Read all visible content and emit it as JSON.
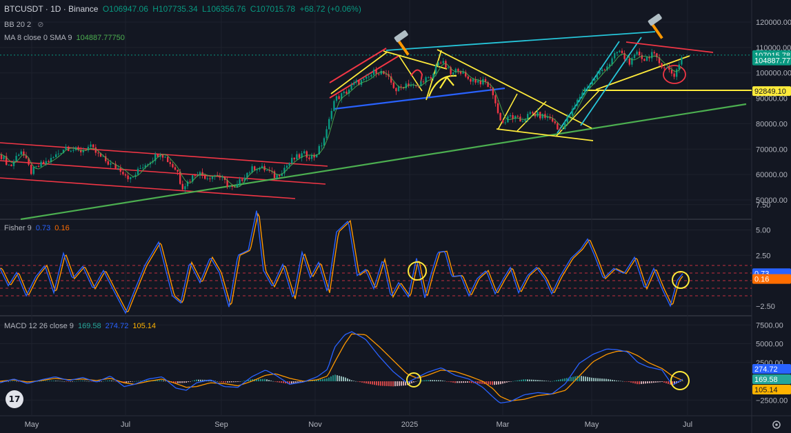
{
  "header": {
    "symbol": "BTCUSDT · 1D · Binance",
    "open": "O106947.06",
    "high": "H107735.34",
    "low": "L106356.76",
    "close": "C107015.78",
    "change": "+68.72 (+0.06%)",
    "bb_label": "BB 20 2",
    "ma_label": "MA 8 close 0 SMA 9",
    "ma_value": "104887.77750"
  },
  "fisher": {
    "label": "Fisher 9",
    "v1": "0.73",
    "v2": "0.16"
  },
  "macd": {
    "label": "MACD 12 26 close 9",
    "v1": "169.58",
    "v2": "274.72",
    "v3": "105.14"
  },
  "chart_data": {
    "type": "candlestick",
    "x_ticks": [
      "May",
      "Jul",
      "Sep",
      "Nov",
      "2025",
      "Mar",
      "May",
      "Jul"
    ],
    "price_axis": [
      "120000.00",
      "110000.00",
      "100000.00",
      "90000.00",
      "80000.00",
      "70000.00",
      "60000.00",
      "50000.00"
    ],
    "fisher_axis": [
      "7.50",
      "5.00",
      "2.50",
      "−2.50"
    ],
    "macd_axis": [
      "7500.00",
      "5000.00",
      "2500.00",
      "−2500.00"
    ],
    "price_labels": [
      {
        "text": "107015.78",
        "color": "#089981",
        "price": 107015.78
      },
      {
        "text": "104887.777",
        "color": "#089981",
        "price": 104887.777
      },
      {
        "text": "92849.10",
        "color": "#ffeb3b",
        "price": 92849.1
      }
    ],
    "fisher_labels": [
      {
        "text": "0.73",
        "color": "#2962ff",
        "value": 0.73
      },
      {
        "text": "0.16",
        "color": "#ff6d00",
        "value": 0.16
      }
    ],
    "macd_labels": [
      {
        "text": "274.72",
        "color": "#2962ff",
        "value": 274.72
      },
      {
        "text": "169.58",
        "color": "#26a69a",
        "value": 169.58
      },
      {
        "text": "105.14",
        "color": "#ffb300",
        "value": 105.14
      }
    ],
    "colors": {
      "up": "#089981",
      "down": "#f23645",
      "fisher": "#2962ff",
      "trigger": "#ff9800",
      "macd": "#2962ff",
      "signal": "#ff9800"
    },
    "price_path": [
      [
        0,
        68000
      ],
      [
        15,
        63000
      ],
      [
        30,
        70000
      ],
      [
        45,
        61000
      ],
      [
        60,
        64000
      ],
      [
        75,
        66000
      ],
      [
        95,
        71000
      ],
      [
        115,
        69000
      ],
      [
        130,
        71000
      ],
      [
        145,
        67000
      ],
      [
        160,
        64000
      ],
      [
        175,
        62000
      ],
      [
        190,
        58000
      ],
      [
        205,
        63000
      ],
      [
        220,
        66000
      ],
      [
        232,
        69000
      ],
      [
        245,
        65000
      ],
      [
        258,
        61000
      ],
      [
        263,
        55000
      ],
      [
        272,
        57000
      ],
      [
        285,
        61000
      ],
      [
        300,
        59000
      ],
      [
        315,
        60000
      ],
      [
        330,
        56000
      ],
      [
        340,
        54000
      ],
      [
        355,
        60000
      ],
      [
        370,
        63000
      ],
      [
        385,
        62000
      ],
      [
        400,
        59000
      ],
      [
        410,
        62000
      ],
      [
        425,
        66000
      ],
      [
        440,
        68000
      ],
      [
        455,
        67000
      ],
      [
        465,
        71000
      ],
      [
        475,
        78000
      ],
      [
        482,
        88000
      ],
      [
        488,
        90000
      ],
      [
        500,
        92000
      ],
      [
        515,
        96000
      ],
      [
        530,
        97000
      ],
      [
        545,
        101000
      ],
      [
        555,
        100000
      ],
      [
        565,
        97000
      ],
      [
        575,
        93000
      ],
      [
        590,
        96000
      ],
      [
        605,
        94000
      ],
      [
        615,
        98000
      ],
      [
        625,
        97000
      ],
      [
        635,
        105000
      ],
      [
        645,
        103000
      ],
      [
        655,
        99000
      ],
      [
        665,
        102000
      ],
      [
        675,
        98000
      ],
      [
        690,
        97000
      ],
      [
        705,
        96000
      ],
      [
        715,
        92000
      ],
      [
        722,
        84000
      ],
      [
        730,
        80000
      ],
      [
        740,
        83000
      ],
      [
        755,
        81000
      ],
      [
        770,
        84000
      ],
      [
        785,
        83000
      ],
      [
        800,
        82000
      ],
      [
        810,
        77000
      ],
      [
        818,
        80000
      ],
      [
        830,
        85000
      ],
      [
        845,
        93000
      ],
      [
        860,
        97000
      ],
      [
        872,
        101000
      ],
      [
        885,
        104000
      ],
      [
        897,
        109000
      ],
      [
        905,
        106000
      ],
      [
        915,
        104000
      ],
      [
        925,
        108000
      ],
      [
        935,
        105000
      ],
      [
        945,
        108000
      ],
      [
        955,
        104000
      ],
      [
        962,
        103000
      ],
      [
        970,
        101000
      ],
      [
        978,
        99000
      ],
      [
        985,
        104000
      ],
      [
        990,
        107000
      ]
    ],
    "fisher_path": [
      [
        0,
        1.2
      ],
      [
        12,
        -0.5
      ],
      [
        24,
        0.8
      ],
      [
        38,
        -1.5
      ],
      [
        52,
        0.4
      ],
      [
        65,
        1.5
      ],
      [
        78,
        -1.2
      ],
      [
        92,
        2.7
      ],
      [
        105,
        0.2
      ],
      [
        120,
        1.4
      ],
      [
        135,
        -0.8
      ],
      [
        150,
        1.0
      ],
      [
        165,
        -1.0
      ],
      [
        182,
        -3.2
      ],
      [
        195,
        -1.0
      ],
      [
        210,
        1.5
      ],
      [
        230,
        3.8
      ],
      [
        250,
        -1.5
      ],
      [
        262,
        -2.2
      ],
      [
        275,
        1.8
      ],
      [
        290,
        -0.2
      ],
      [
        305,
        2.3
      ],
      [
        318,
        0.8
      ],
      [
        332,
        -2.6
      ],
      [
        345,
        2.5
      ],
      [
        360,
        3.0
      ],
      [
        372,
        6.9
      ],
      [
        382,
        1.0
      ],
      [
        395,
        -0.6
      ],
      [
        410,
        1.6
      ],
      [
        425,
        -1.8
      ],
      [
        438,
        2.8
      ],
      [
        450,
        0.3
      ],
      [
        462,
        1.8
      ],
      [
        475,
        -1.2
      ],
      [
        488,
        4.8
      ],
      [
        505,
        5.9
      ],
      [
        518,
        0.5
      ],
      [
        530,
        1.1
      ],
      [
        542,
        -0.8
      ],
      [
        555,
        2.1
      ],
      [
        567,
        -1.6
      ],
      [
        578,
        -0.2
      ],
      [
        592,
        -1.6
      ],
      [
        604,
        2.2
      ],
      [
        616,
        -1.7
      ],
      [
        625,
        0.6
      ],
      [
        635,
        2.8
      ],
      [
        645,
        2.9
      ],
      [
        655,
        0.4
      ],
      [
        668,
        0.5
      ],
      [
        680,
        -1.5
      ],
      [
        692,
        0.2
      ],
      [
        705,
        1.0
      ],
      [
        718,
        -1.3
      ],
      [
        730,
        0.2
      ],
      [
        740,
        1.3
      ],
      [
        752,
        -1.2
      ],
      [
        765,
        0.5
      ],
      [
        778,
        1.3
      ],
      [
        790,
        0.2
      ],
      [
        800,
        -1.3
      ],
      [
        812,
        0.4
      ],
      [
        828,
        2.2
      ],
      [
        842,
        3.1
      ],
      [
        852,
        4.1
      ],
      [
        862,
        2.5
      ],
      [
        875,
        0.2
      ],
      [
        890,
        1.2
      ],
      [
        905,
        0.7
      ],
      [
        920,
        2.3
      ],
      [
        935,
        -0.8
      ],
      [
        948,
        1.2
      ],
      [
        960,
        -0.8
      ],
      [
        972,
        -2.5
      ],
      [
        982,
        0.0
      ],
      [
        990,
        0.7
      ]
    ],
    "macd_path": [
      [
        0,
        -200
      ],
      [
        20,
        300
      ],
      [
        40,
        -300
      ],
      [
        60,
        200
      ],
      [
        80,
        600
      ],
      [
        100,
        100
      ],
      [
        120,
        500
      ],
      [
        140,
        -100
      ],
      [
        160,
        700
      ],
      [
        180,
        -700
      ],
      [
        195,
        -400
      ],
      [
        215,
        300
      ],
      [
        235,
        600
      ],
      [
        255,
        -900
      ],
      [
        270,
        -1200
      ],
      [
        285,
        -200
      ],
      [
        305,
        200
      ],
      [
        325,
        -700
      ],
      [
        345,
        -800
      ],
      [
        365,
        600
      ],
      [
        385,
        1500
      ],
      [
        400,
        800
      ],
      [
        420,
        -400
      ],
      [
        440,
        -100
      ],
      [
        460,
        600
      ],
      [
        475,
        1600
      ],
      [
        485,
        4500
      ],
      [
        500,
        6200
      ],
      [
        510,
        6600
      ],
      [
        530,
        5600
      ],
      [
        550,
        3300
      ],
      [
        570,
        1300
      ],
      [
        590,
        -200
      ],
      [
        605,
        500
      ],
      [
        620,
        1200
      ],
      [
        640,
        1800
      ],
      [
        660,
        800
      ],
      [
        680,
        300
      ],
      [
        700,
        -800
      ],
      [
        715,
        -2100
      ],
      [
        725,
        -2900
      ],
      [
        740,
        -2700
      ],
      [
        760,
        -1800
      ],
      [
        780,
        -1500
      ],
      [
        800,
        -1700
      ],
      [
        820,
        -300
      ],
      [
        840,
        2400
      ],
      [
        860,
        3600
      ],
      [
        880,
        4300
      ],
      [
        895,
        4200
      ],
      [
        910,
        3900
      ],
      [
        925,
        2500
      ],
      [
        940,
        1900
      ],
      [
        960,
        1500
      ],
      [
        975,
        -500
      ],
      [
        990,
        270
      ]
    ],
    "signal_path": [
      [
        0,
        0
      ],
      [
        20,
        200
      ],
      [
        40,
        -100
      ],
      [
        60,
        100
      ],
      [
        80,
        400
      ],
      [
        100,
        200
      ],
      [
        120,
        300
      ],
      [
        140,
        100
      ],
      [
        160,
        400
      ],
      [
        180,
        -200
      ],
      [
        195,
        -400
      ],
      [
        215,
        0
      ],
      [
        235,
        300
      ],
      [
        255,
        -300
      ],
      [
        270,
        -800
      ],
      [
        285,
        -700
      ],
      [
        305,
        -200
      ],
      [
        325,
        -300
      ],
      [
        345,
        -600
      ],
      [
        365,
        0
      ],
      [
        385,
        800
      ],
      [
        400,
        1000
      ],
      [
        420,
        400
      ],
      [
        440,
        0
      ],
      [
        460,
        200
      ],
      [
        475,
        700
      ],
      [
        485,
        2500
      ],
      [
        500,
        5000
      ],
      [
        510,
        6300
      ],
      [
        530,
        6200
      ],
      [
        550,
        4600
      ],
      [
        570,
        2800
      ],
      [
        590,
        1000
      ],
      [
        605,
        400
      ],
      [
        620,
        800
      ],
      [
        640,
        1500
      ],
      [
        660,
        1300
      ],
      [
        680,
        700
      ],
      [
        700,
        0
      ],
      [
        715,
        -1000
      ],
      [
        725,
        -2000
      ],
      [
        740,
        -2600
      ],
      [
        760,
        -2400
      ],
      [
        780,
        -1900
      ],
      [
        800,
        -1700
      ],
      [
        820,
        -1200
      ],
      [
        840,
        700
      ],
      [
        860,
        2600
      ],
      [
        880,
        3600
      ],
      [
        895,
        4000
      ],
      [
        910,
        4000
      ],
      [
        925,
        3400
      ],
      [
        940,
        2500
      ],
      [
        960,
        1700
      ],
      [
        975,
        700
      ],
      [
        990,
        105
      ]
    ],
    "annotations": "trendlines, channels, circles and hammer icons drawn on chart"
  }
}
